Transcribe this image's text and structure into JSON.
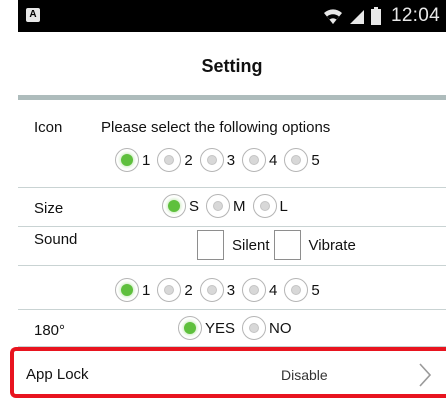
{
  "status_bar": {
    "notification_icon": "A",
    "time": "12:04",
    "icons": [
      "wifi-icon",
      "signal-icon",
      "battery-icon"
    ]
  },
  "header": {
    "title": "Setting"
  },
  "icon_section": {
    "label": "Icon",
    "prompt": "Please select the following options",
    "options": [
      "1",
      "2",
      "3",
      "4",
      "5"
    ],
    "selected": "1"
  },
  "size_section": {
    "label": "Size",
    "options": [
      "S",
      "M",
      "L"
    ],
    "selected": "S"
  },
  "sound_section": {
    "label": "Sound",
    "checkboxes": [
      {
        "label": "Silent",
        "checked": false
      },
      {
        "label": "Vibrate",
        "checked": false
      }
    ],
    "options": [
      "1",
      "2",
      "3",
      "4",
      "5"
    ],
    "selected": "1"
  },
  "rotate_section": {
    "label": "180°",
    "options": [
      "YES",
      "NO"
    ],
    "selected": "YES"
  },
  "app_lock": {
    "label": "App Lock",
    "value": "Disable"
  },
  "colors": {
    "selected_radio": "#5ec03c",
    "highlight_border": "#e8141f",
    "divider": "#aebcbc",
    "status_bar": "#000000"
  }
}
